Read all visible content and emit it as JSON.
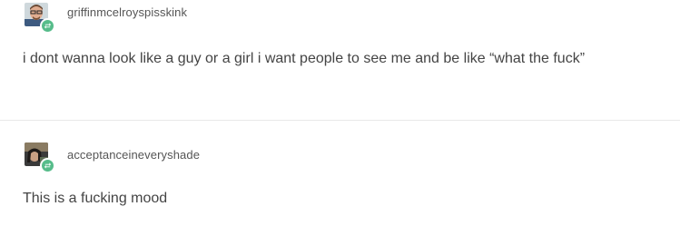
{
  "posts": [
    {
      "username": "griffinmcelroyspisskink",
      "avatar_icon": "avatar-man-glasses",
      "badge_icon": "reblog-icon",
      "text": "i dont wanna look like a guy or a girl i want people to see me and be like “what the fuck”"
    },
    {
      "username": "acceptanceineveryshade",
      "avatar_icon": "avatar-dark-photo",
      "badge_icon": "reblog-icon",
      "text": "This is a fucking mood"
    }
  ],
  "colors": {
    "badge_green": "#56bc8a",
    "text": "#444444",
    "username": "#555555",
    "divider": "#e8e8e8"
  }
}
